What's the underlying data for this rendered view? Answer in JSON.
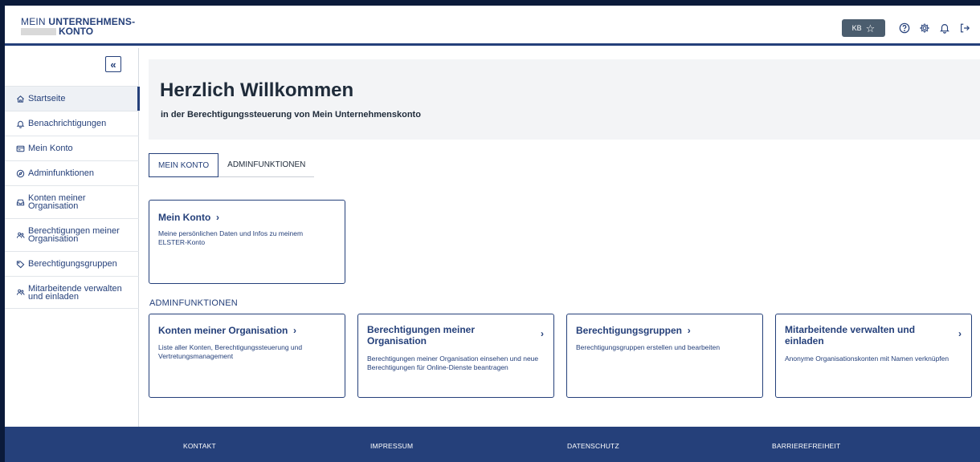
{
  "header": {
    "logo_line1_prefix": "MEIN ",
    "logo_line1_bold": "UNTERNEHMENS-",
    "logo_line2": "KONTO",
    "badge_initials": "KB",
    "badge_icon": "star-outline-icon",
    "icons": [
      "help-icon",
      "gear-icon",
      "bell-icon",
      "logout-icon"
    ]
  },
  "sidebar": {
    "collapse_label": "«",
    "items": [
      {
        "label": "Startseite",
        "icon": "home-icon",
        "active": true
      },
      {
        "label": "Benachrichtigungen",
        "icon": "bell-icon"
      },
      {
        "label": "Mein Konto",
        "icon": "id-card-icon"
      },
      {
        "label": "Adminfunktionen",
        "icon": "compass-icon"
      },
      {
        "label": "Konten meiner\nOrganisation",
        "icon": "inbox-icon"
      },
      {
        "label": "Berechtigungen meiner\nOrganisation",
        "icon": "users-key-icon"
      },
      {
        "label": "Berechtigungsgruppen",
        "icon": "tag-icon"
      },
      {
        "label": "Mitarbeitende verwalten\nund einladen",
        "icon": "users-icon"
      }
    ]
  },
  "welcome": {
    "title": "Herzlich Willkommen",
    "subtitle": "in der Berechtigungssteuerung von Mein Unternehmenskonto"
  },
  "tabs": [
    {
      "label": "MEIN KONTO",
      "active": true
    },
    {
      "label": "ADMINFUNKTIONEN",
      "active": false
    }
  ],
  "mein_konto_card": {
    "title": "Mein Konto",
    "chevron": "›",
    "desc": "Meine persönlichen Daten und Infos zu meinem ELSTER-Konto"
  },
  "admin_section_label": "ADMINFUNKTIONEN",
  "admin_cards": [
    {
      "title": "Konten meiner Organisation",
      "desc": "Liste aller Konten, Berechtigungssteuerung und Vertretungsmanagement"
    },
    {
      "title": "Berechtigungen meiner Organisation",
      "desc": "Berechtigungen meiner Organisation einsehen und neue Berechtigungen für Online-Dienste beantragen"
    },
    {
      "title": "Berechtigungsgruppen",
      "desc": "Berechtigungsgruppen erstellen und bearbeiten"
    },
    {
      "title": "Mitarbeitende verwalten und einladen",
      "desc": "Anonyme Organisationskonten mit Namen verknüpfen"
    }
  ],
  "chevron": "›",
  "footer": {
    "links": [
      "KONTAKT",
      "IMPRESSUM",
      "DATENSCHUTZ",
      "BARRIEREFREIHEIT"
    ]
  },
  "colors": {
    "primary": "#25407a",
    "badge": "#4b5d6e",
    "welcome_bg": "#f3f4f6"
  }
}
